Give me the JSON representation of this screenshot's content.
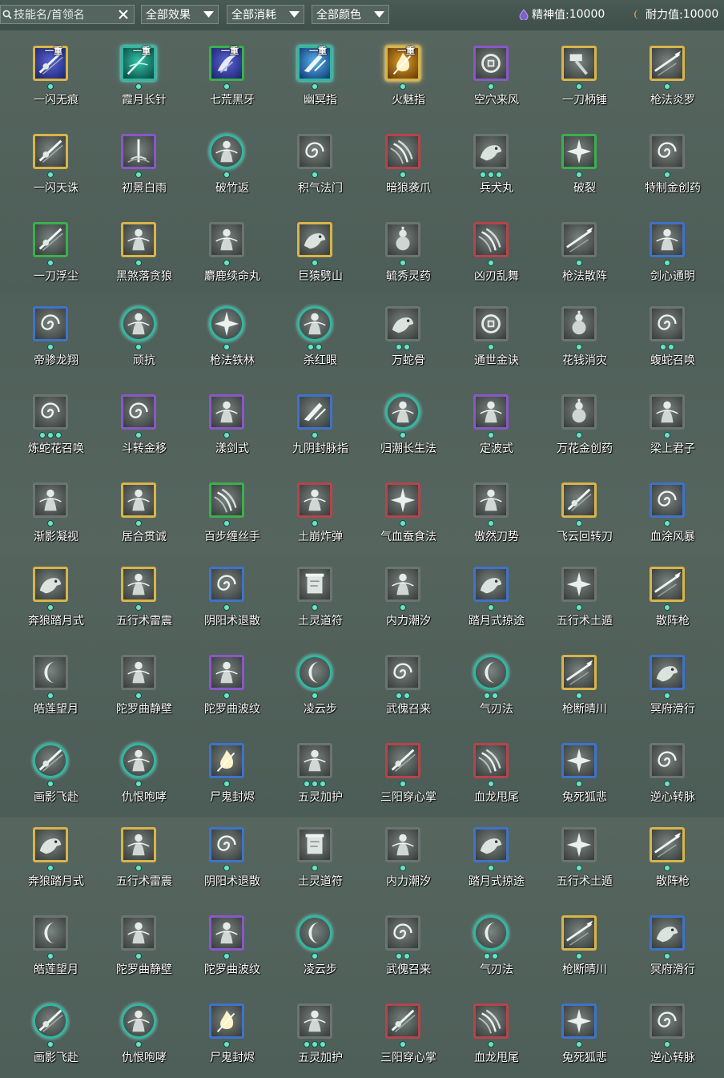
{
  "filters": {
    "search_placeholder": "技能名/首领名",
    "effect_label": "全部效果",
    "cost_label": "全部消耗",
    "color_label": "全部颜色"
  },
  "stats": {
    "spirit_label": "精神值:",
    "spirit_value": "10000",
    "stamina_label": "耐力值:",
    "stamina_value": "10000"
  },
  "colors": {
    "gold": "#d8b449",
    "purple": "#8a57c8",
    "green": "#3ab04c",
    "blue": "#3f73c9",
    "red": "#b8434a",
    "gray": "#6c7472",
    "teal": "#2fb8a2",
    "dot": "#68e5c8"
  },
  "skills": [
    {
      "name": "一闪无痕",
      "frame": "gold",
      "shape": "square",
      "dots": 1,
      "tag": "一重",
      "glyph": "blade-slash",
      "tint": "color-blue"
    },
    {
      "name": "霞月长针",
      "frame": "teal",
      "shape": "glow",
      "dots": 1,
      "tag": "一重",
      "glyph": "needle",
      "tint": "color-green"
    },
    {
      "name": "七荒黑牙",
      "frame": "green",
      "shape": "square",
      "dots": 1,
      "tag": "一重",
      "glyph": "fang",
      "tint": "color-blue"
    },
    {
      "name": "幽冥指",
      "frame": "teal",
      "shape": "glow",
      "dots": 1,
      "tag": "一重",
      "glyph": "finger",
      "tint": "color-cyan"
    },
    {
      "name": "火魅指",
      "frame": "gold",
      "shape": "glow",
      "dots": 1,
      "tag": "一重",
      "glyph": "fire",
      "tint": "color-gold"
    },
    {
      "name": "空穴来风",
      "frame": "purple",
      "shape": "square",
      "dots": 1,
      "tag": "",
      "glyph": "coin",
      "tint": "gray"
    },
    {
      "name": "一刀柄锤",
      "frame": "gold",
      "shape": "square",
      "dots": 1,
      "tag": "",
      "glyph": "hammer",
      "tint": "gray"
    },
    {
      "name": "枪法炎罗",
      "frame": "gold",
      "shape": "square",
      "dots": 1,
      "tag": "",
      "glyph": "spear",
      "tint": "gray"
    },
    {
      "name": "一闪天诛",
      "frame": "gold",
      "shape": "square",
      "dots": 1,
      "tag": "",
      "glyph": "blade-slash",
      "tint": "gray"
    },
    {
      "name": "初景白雨",
      "frame": "purple",
      "shape": "square",
      "dots": 1,
      "tag": "",
      "glyph": "rain",
      "tint": "gray"
    },
    {
      "name": "破竹返",
      "frame": "teal",
      "shape": "round",
      "dots": 1,
      "tag": "",
      "glyph": "figure",
      "tint": "gray"
    },
    {
      "name": "积气法门",
      "frame": "gray",
      "shape": "square",
      "dots": 1,
      "tag": "",
      "glyph": "swirl",
      "tint": "gray"
    },
    {
      "name": "暗狼袭爪",
      "frame": "red",
      "shape": "square",
      "dots": 1,
      "tag": "",
      "glyph": "claw",
      "tint": "gray"
    },
    {
      "name": "兵犬丸",
      "frame": "gray",
      "shape": "square",
      "dots": 3,
      "tag": "",
      "glyph": "beast",
      "tint": "gray"
    },
    {
      "name": "破裂",
      "frame": "green",
      "shape": "square",
      "dots": 1,
      "tag": "",
      "glyph": "burst",
      "tint": "gray"
    },
    {
      "name": "特制金创药",
      "frame": "gray",
      "shape": "square",
      "dots": 1,
      "tag": "",
      "glyph": "swirl",
      "tint": "gray"
    },
    {
      "name": "一刀浮尘",
      "frame": "green",
      "shape": "square",
      "dots": 1,
      "tag": "",
      "glyph": "blade-slash",
      "tint": "gray"
    },
    {
      "name": "黑煞落贪狼",
      "frame": "gold",
      "shape": "square",
      "dots": 1,
      "tag": "",
      "glyph": "figure",
      "tint": "gray"
    },
    {
      "name": "麝鹿续命丸",
      "frame": "gray",
      "shape": "square",
      "dots": 1,
      "tag": "",
      "glyph": "figure",
      "tint": "gray"
    },
    {
      "name": "巨猿劈山",
      "frame": "gold",
      "shape": "square",
      "dots": 1,
      "tag": "",
      "glyph": "beast",
      "tint": "gray"
    },
    {
      "name": "毓秀灵药",
      "frame": "gray",
      "shape": "square",
      "dots": 1,
      "tag": "",
      "glyph": "gourd",
      "tint": "gray"
    },
    {
      "name": "凶刃乱舞",
      "frame": "red",
      "shape": "square",
      "dots": 1,
      "tag": "",
      "glyph": "claw",
      "tint": "gray"
    },
    {
      "name": "枪法散阵",
      "frame": "gray",
      "shape": "square",
      "dots": 1,
      "tag": "",
      "glyph": "spear",
      "tint": "gray"
    },
    {
      "name": "剑心通明",
      "frame": "blue",
      "shape": "square",
      "dots": 1,
      "tag": "",
      "glyph": "figure",
      "tint": "gray"
    },
    {
      "name": "帝骖龙翔",
      "frame": "blue",
      "shape": "square",
      "dots": 1,
      "tag": "",
      "glyph": "swirl",
      "tint": "gray"
    },
    {
      "name": "顽抗",
      "frame": "teal",
      "shape": "round",
      "dots": 1,
      "tag": "",
      "glyph": "figure",
      "tint": "gray"
    },
    {
      "name": "枪法铁林",
      "frame": "teal",
      "shape": "round",
      "dots": 1,
      "tag": "",
      "glyph": "burst",
      "tint": "gray"
    },
    {
      "name": "杀红眼",
      "frame": "teal",
      "shape": "round",
      "dots": 2,
      "tag": "",
      "glyph": "figure",
      "tint": "gray"
    },
    {
      "name": "万蛇骨",
      "frame": "gray",
      "shape": "square",
      "dots": 2,
      "tag": "",
      "glyph": "beast",
      "tint": "gray"
    },
    {
      "name": "通世金诀",
      "frame": "gray",
      "shape": "square",
      "dots": 1,
      "tag": "",
      "glyph": "coin",
      "tint": "gray"
    },
    {
      "name": "花钱消灾",
      "frame": "gray",
      "shape": "square",
      "dots": 1,
      "tag": "",
      "glyph": "gourd",
      "tint": "gray"
    },
    {
      "name": "蝮蛇召唤",
      "frame": "gray",
      "shape": "square",
      "dots": 2,
      "tag": "",
      "glyph": "swirl",
      "tint": "gray"
    },
    {
      "name": "炼蛇花召唤",
      "frame": "gray",
      "shape": "square",
      "dots": 3,
      "tag": "",
      "glyph": "swirl",
      "tint": "gray"
    },
    {
      "name": "斗转金移",
      "frame": "purple",
      "shape": "square",
      "dots": 1,
      "tag": "",
      "glyph": "swirl",
      "tint": "gray"
    },
    {
      "name": "漾剑式",
      "frame": "purple",
      "shape": "square",
      "dots": 1,
      "tag": "",
      "glyph": "figure",
      "tint": "gray"
    },
    {
      "name": "九阴封脉指",
      "frame": "blue",
      "shape": "square",
      "dots": 1,
      "tag": "",
      "glyph": "finger",
      "tint": "gray"
    },
    {
      "name": "归潮长生法",
      "frame": "teal",
      "shape": "round",
      "dots": 1,
      "tag": "",
      "glyph": "figure",
      "tint": "gray"
    },
    {
      "name": "定波式",
      "frame": "purple",
      "shape": "square",
      "dots": 1,
      "tag": "",
      "glyph": "figure",
      "tint": "gray"
    },
    {
      "name": "万花金创药",
      "frame": "gray",
      "shape": "square",
      "dots": 1,
      "tag": "",
      "glyph": "gourd",
      "tint": "gray"
    },
    {
      "name": "梁上君子",
      "frame": "gray",
      "shape": "square",
      "dots": 1,
      "tag": "",
      "glyph": "figure",
      "tint": "gray"
    },
    {
      "name": "渐影凝视",
      "frame": "gray",
      "shape": "square",
      "dots": 1,
      "tag": "",
      "glyph": "figure",
      "tint": "gray"
    },
    {
      "name": "居合贯诚",
      "frame": "gold",
      "shape": "square",
      "dots": 1,
      "tag": "",
      "glyph": "figure",
      "tint": "gray"
    },
    {
      "name": "百步缠丝手",
      "frame": "green",
      "shape": "square",
      "dots": 1,
      "tag": "",
      "glyph": "claw",
      "tint": "gray"
    },
    {
      "name": "土崩炸弹",
      "frame": "red",
      "shape": "square",
      "dots": 1,
      "tag": "",
      "glyph": "figure",
      "tint": "gray"
    },
    {
      "name": "气血蚕食法",
      "frame": "red",
      "shape": "square",
      "dots": 1,
      "tag": "",
      "glyph": "burst",
      "tint": "gray"
    },
    {
      "name": "傲然刀势",
      "frame": "gray",
      "shape": "square",
      "dots": 1,
      "tag": "",
      "glyph": "figure",
      "tint": "gray"
    },
    {
      "name": "飞云回转刀",
      "frame": "gold",
      "shape": "square",
      "dots": 1,
      "tag": "",
      "glyph": "blade-slash",
      "tint": "gray"
    },
    {
      "name": "血涂风暴",
      "frame": "blue",
      "shape": "square",
      "dots": 1,
      "tag": "",
      "glyph": "swirl",
      "tint": "gray"
    },
    {
      "name": "奔狼踏月式",
      "frame": "gold",
      "shape": "square",
      "dots": 1,
      "tag": "",
      "glyph": "beast",
      "tint": "gray"
    },
    {
      "name": "五行术雷震",
      "frame": "gold",
      "shape": "square",
      "dots": 1,
      "tag": "",
      "glyph": "figure",
      "tint": "gray"
    },
    {
      "name": "阴阳术退散",
      "frame": "blue",
      "shape": "square",
      "dots": 1,
      "tag": "",
      "glyph": "swirl",
      "tint": "gray"
    },
    {
      "name": "土灵道符",
      "frame": "gray",
      "shape": "square",
      "dots": 1,
      "tag": "",
      "glyph": "scroll",
      "tint": "gray"
    },
    {
      "name": "内力潮汐",
      "frame": "gray",
      "shape": "square",
      "dots": 1,
      "tag": "",
      "glyph": "figure",
      "tint": "gray"
    },
    {
      "name": "踏月式掠途",
      "frame": "blue",
      "shape": "square",
      "dots": 1,
      "tag": "",
      "glyph": "beast",
      "tint": "gray"
    },
    {
      "name": "五行术土遁",
      "frame": "gray",
      "shape": "square",
      "dots": 1,
      "tag": "",
      "glyph": "burst",
      "tint": "gray"
    },
    {
      "name": "散阵枪",
      "frame": "gold",
      "shape": "square",
      "dots": 1,
      "tag": "",
      "glyph": "spear",
      "tint": "gray"
    },
    {
      "name": "皓莲望月",
      "frame": "gray",
      "shape": "square",
      "dots": 1,
      "tag": "",
      "glyph": "moon",
      "tint": "gray"
    },
    {
      "name": "陀罗曲静壁",
      "frame": "gray",
      "shape": "square",
      "dots": 1,
      "tag": "",
      "glyph": "figure",
      "tint": "gray"
    },
    {
      "name": "陀罗曲波纹",
      "frame": "purple",
      "shape": "square",
      "dots": 1,
      "tag": "",
      "glyph": "figure",
      "tint": "gray"
    },
    {
      "name": "凌云步",
      "frame": "teal",
      "shape": "round",
      "dots": 1,
      "tag": "",
      "glyph": "moon",
      "tint": "gray"
    },
    {
      "name": "武傀召来",
      "frame": "gray",
      "shape": "square",
      "dots": 2,
      "tag": "",
      "glyph": "swirl",
      "tint": "gray"
    },
    {
      "name": "气刃法",
      "frame": "teal",
      "shape": "round",
      "dots": 2,
      "tag": "",
      "glyph": "moon",
      "tint": "gray"
    },
    {
      "name": "枪断晴川",
      "frame": "gold",
      "shape": "square",
      "dots": 1,
      "tag": "",
      "glyph": "spear",
      "tint": "gray"
    },
    {
      "name": "冥府滑行",
      "frame": "blue",
      "shape": "square",
      "dots": 1,
      "tag": "",
      "glyph": "beast",
      "tint": "gray"
    },
    {
      "name": "画影飞赴",
      "frame": "teal",
      "shape": "round",
      "dots": 1,
      "tag": "",
      "glyph": "blade-slash",
      "tint": "gray"
    },
    {
      "name": "仇恨咆哮",
      "frame": "teal",
      "shape": "round",
      "dots": 1,
      "tag": "",
      "glyph": "figure",
      "tint": "gray"
    },
    {
      "name": "尸鬼封烬",
      "frame": "blue",
      "shape": "square",
      "dots": 1,
      "tag": "",
      "glyph": "fire",
      "tint": "gray"
    },
    {
      "name": "五灵加护",
      "frame": "gray",
      "shape": "square",
      "dots": 3,
      "tag": "",
      "glyph": "figure",
      "tint": "gray"
    },
    {
      "name": "三阳穿心掌",
      "frame": "red",
      "shape": "square",
      "dots": 1,
      "tag": "",
      "glyph": "blade-slash",
      "tint": "gray"
    },
    {
      "name": "血龙甩尾",
      "frame": "red",
      "shape": "square",
      "dots": 1,
      "tag": "",
      "glyph": "claw",
      "tint": "gray"
    },
    {
      "name": "兔死狐悲",
      "frame": "blue",
      "shape": "square",
      "dots": 1,
      "tag": "",
      "glyph": "burst",
      "tint": "gray"
    },
    {
      "name": "逆心转脉",
      "frame": "gray",
      "shape": "square",
      "dots": 1,
      "tag": "",
      "glyph": "swirl",
      "tint": "gray"
    },
    {
      "name": "奔狼踏月式",
      "frame": "gold",
      "shape": "square",
      "dots": 1,
      "tag": "",
      "glyph": "beast",
      "tint": "gray"
    },
    {
      "name": "五行术雷震",
      "frame": "gold",
      "shape": "square",
      "dots": 1,
      "tag": "",
      "glyph": "figure",
      "tint": "gray"
    },
    {
      "name": "阴阳术退散",
      "frame": "blue",
      "shape": "square",
      "dots": 1,
      "tag": "",
      "glyph": "swirl",
      "tint": "gray"
    },
    {
      "name": "土灵道符",
      "frame": "gray",
      "shape": "square",
      "dots": 1,
      "tag": "",
      "glyph": "scroll",
      "tint": "gray"
    },
    {
      "name": "内力潮汐",
      "frame": "gray",
      "shape": "square",
      "dots": 1,
      "tag": "",
      "glyph": "figure",
      "tint": "gray"
    },
    {
      "name": "踏月式掠途",
      "frame": "blue",
      "shape": "square",
      "dots": 1,
      "tag": "",
      "glyph": "beast",
      "tint": "gray"
    },
    {
      "name": "五行术土遁",
      "frame": "gray",
      "shape": "square",
      "dots": 1,
      "tag": "",
      "glyph": "burst",
      "tint": "gray"
    },
    {
      "name": "散阵枪",
      "frame": "gold",
      "shape": "square",
      "dots": 1,
      "tag": "",
      "glyph": "spear",
      "tint": "gray"
    },
    {
      "name": "皓莲望月",
      "frame": "gray",
      "shape": "square",
      "dots": 1,
      "tag": "",
      "glyph": "moon",
      "tint": "gray"
    },
    {
      "name": "陀罗曲静壁",
      "frame": "gray",
      "shape": "square",
      "dots": 1,
      "tag": "",
      "glyph": "figure",
      "tint": "gray"
    },
    {
      "name": "陀罗曲波纹",
      "frame": "purple",
      "shape": "square",
      "dots": 1,
      "tag": "",
      "glyph": "figure",
      "tint": "gray"
    },
    {
      "name": "凌云步",
      "frame": "teal",
      "shape": "round",
      "dots": 1,
      "tag": "",
      "glyph": "moon",
      "tint": "gray"
    },
    {
      "name": "武傀召来",
      "frame": "gray",
      "shape": "square",
      "dots": 2,
      "tag": "",
      "glyph": "swirl",
      "tint": "gray"
    },
    {
      "name": "气刃法",
      "frame": "teal",
      "shape": "round",
      "dots": 2,
      "tag": "",
      "glyph": "moon",
      "tint": "gray"
    },
    {
      "name": "枪断晴川",
      "frame": "gold",
      "shape": "square",
      "dots": 1,
      "tag": "",
      "glyph": "spear",
      "tint": "gray"
    },
    {
      "name": "冥府滑行",
      "frame": "blue",
      "shape": "square",
      "dots": 1,
      "tag": "",
      "glyph": "beast",
      "tint": "gray"
    },
    {
      "name": "画影飞赴",
      "frame": "teal",
      "shape": "round",
      "dots": 1,
      "tag": "",
      "glyph": "blade-slash",
      "tint": "gray"
    },
    {
      "name": "仇恨咆哮",
      "frame": "teal",
      "shape": "round",
      "dots": 1,
      "tag": "",
      "glyph": "figure",
      "tint": "gray"
    },
    {
      "name": "尸鬼封烬",
      "frame": "blue",
      "shape": "square",
      "dots": 1,
      "tag": "",
      "glyph": "fire",
      "tint": "gray"
    },
    {
      "name": "五灵加护",
      "frame": "gray",
      "shape": "square",
      "dots": 3,
      "tag": "",
      "glyph": "figure",
      "tint": "gray"
    },
    {
      "name": "三阳穿心掌",
      "frame": "red",
      "shape": "square",
      "dots": 1,
      "tag": "",
      "glyph": "blade-slash",
      "tint": "gray"
    },
    {
      "name": "血龙甩尾",
      "frame": "red",
      "shape": "square",
      "dots": 1,
      "tag": "",
      "glyph": "claw",
      "tint": "gray"
    },
    {
      "name": "兔死狐悲",
      "frame": "blue",
      "shape": "square",
      "dots": 1,
      "tag": "",
      "glyph": "burst",
      "tint": "gray"
    },
    {
      "name": "逆心转脉",
      "frame": "gray",
      "shape": "square",
      "dots": 1,
      "tag": "",
      "glyph": "swirl",
      "tint": "gray"
    }
  ]
}
